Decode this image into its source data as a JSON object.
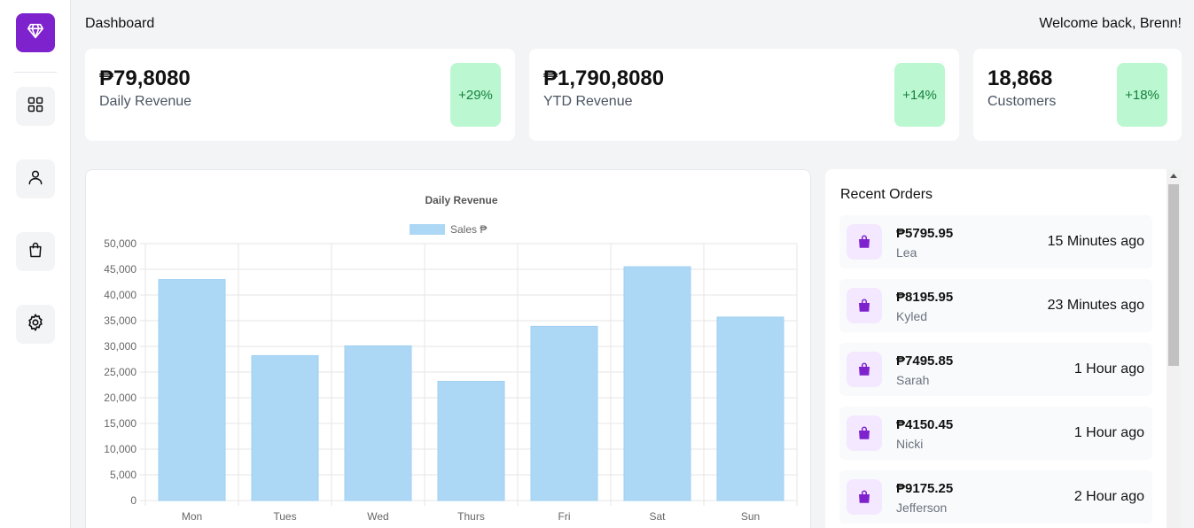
{
  "header": {
    "title": "Dashboard",
    "welcome": "Welcome back, Brenn!"
  },
  "sidebar": {
    "logo_icon": "diamond-icon",
    "items": [
      {
        "icon": "grid-icon"
      },
      {
        "icon": "user-icon"
      },
      {
        "icon": "shopping-bag-icon"
      },
      {
        "icon": "gear-icon"
      }
    ]
  },
  "stats": [
    {
      "value": "₱79,8080",
      "label": "Daily Revenue",
      "change": "+29%"
    },
    {
      "value": "₱1,790,8080",
      "label": "YTD Revenue",
      "change": "+14%"
    },
    {
      "value": "18,868",
      "label": "Customers",
      "change": "+18%"
    }
  ],
  "colors": {
    "brand": "#7e22ce",
    "badge_bg": "#bbf7d0",
    "badge_text": "#15803d",
    "bar": "#add8f5"
  },
  "chart_data": {
    "type": "bar",
    "title": "Daily Revenue",
    "categories": [
      "Mon",
      "Tues",
      "Wed",
      "Thurs",
      "Fri",
      "Sat",
      "Sun"
    ],
    "series": [
      {
        "name": "Sales ₱",
        "values": [
          43000,
          28200,
          30100,
          23200,
          33900,
          45500,
          35700
        ]
      }
    ],
    "ylim": [
      0,
      50000
    ],
    "yticks": [
      "0",
      "5,000",
      "10,000",
      "15,000",
      "20,000",
      "25,000",
      "30,000",
      "35,000",
      "40,000",
      "45,000",
      "50,000"
    ],
    "grid": true,
    "legend": "top"
  },
  "orders": {
    "title": "Recent Orders",
    "items": [
      {
        "amount": "₱5795.95",
        "name": "Lea",
        "time": "15 Minutes ago"
      },
      {
        "amount": "₱8195.95",
        "name": "Kyled",
        "time": "23 Minutes ago"
      },
      {
        "amount": "₱7495.85",
        "name": "Sarah",
        "time": "1 Hour ago"
      },
      {
        "amount": "₱4150.45",
        "name": "Nicki",
        "time": "1 Hour ago"
      },
      {
        "amount": "₱9175.25",
        "name": "Jefferson",
        "time": "2 Hour ago"
      }
    ]
  }
}
